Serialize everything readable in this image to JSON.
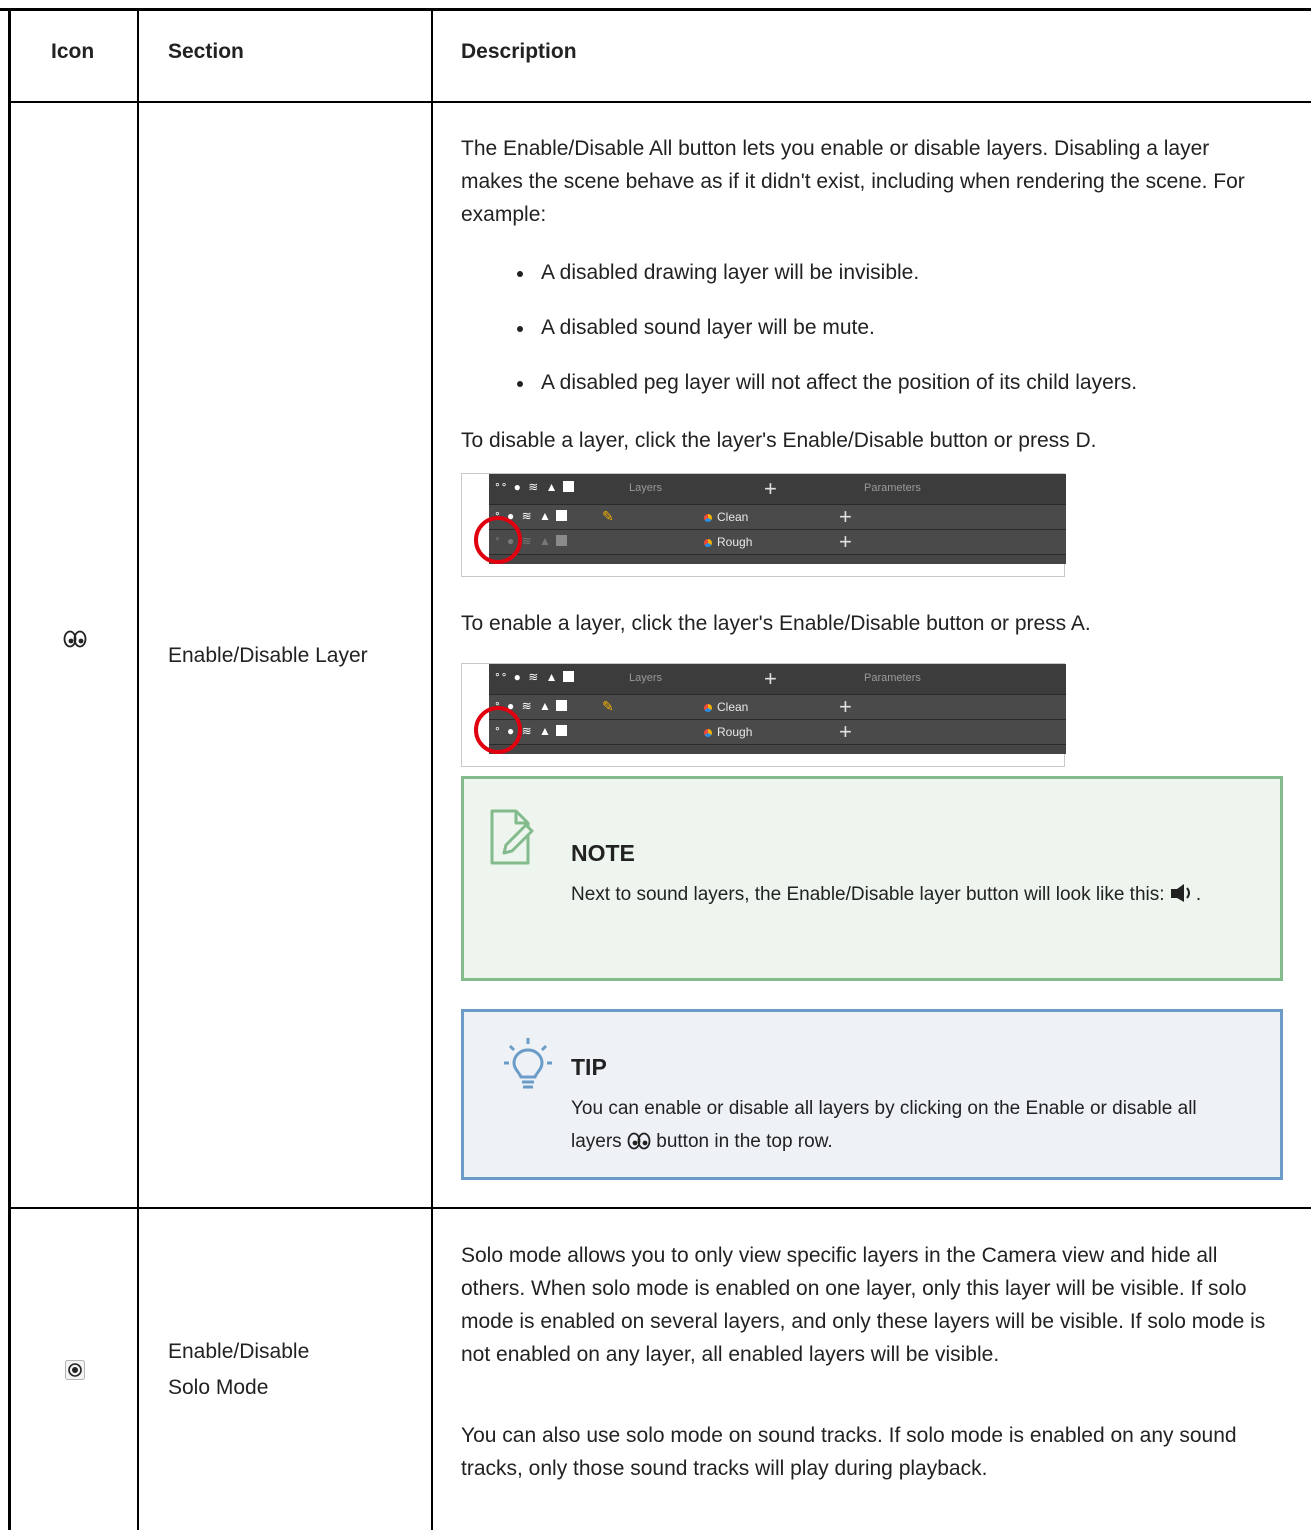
{
  "table": {
    "headers": {
      "icon": "Icon",
      "section": "Section",
      "description": "Description"
    }
  },
  "row1": {
    "icon_name": "enable-disable-all-icon",
    "section": "Enable/Disable Layer",
    "intro": "The Enable/Disable All button lets you enable or disable layers. Disabling a layer makes the scene behave as if it didn't exist, including when rendering the scene. For example:",
    "bullets": [
      "A disabled drawing layer will be invisible.",
      "A disabled sound layer will be mute.",
      "A disabled peg layer will not affect the position of its child layers."
    ],
    "disable_instruction": "To disable a layer, click the layer's Enable/Disable button or press D.",
    "enable_instruction": "To enable a layer, click the layer's Enable/Disable button or press A.",
    "screenshot": {
      "header_layers": "Layers",
      "header_parameters": "Parameters",
      "layer_1": "Clean",
      "layer_2": "Rough"
    },
    "note": {
      "title": "NOTE",
      "body_before": "Next to sound layers, the Enable/Disable layer button will look like this: ",
      "body_after": "."
    },
    "tip": {
      "title": "TIP",
      "body_before": "You can enable or disable all layers by clicking on the Enable or disable all layers ",
      "body_after": " button in the top row."
    }
  },
  "row2": {
    "icon_name": "solo-mode-icon",
    "section_line1": "Enable/Disable",
    "section_line2": "Solo Mode",
    "para1": "Solo mode allows you to only view specific layers in the Camera view and hide all others. When solo mode is enabled on one layer, only this layer will be visible. If solo mode is enabled on several layers, and only these layers will be visible. If solo mode is not enabled on any layer, all enabled layers will be visible.",
    "para2": "You can also use solo mode on sound tracks. If solo mode is enabled on any sound tracks, only those sound tracks will play during playback."
  },
  "colors": {
    "note_border": "#83bb8d",
    "tip_border": "#6a9cc7",
    "highlight_ring": "#e0000f"
  }
}
